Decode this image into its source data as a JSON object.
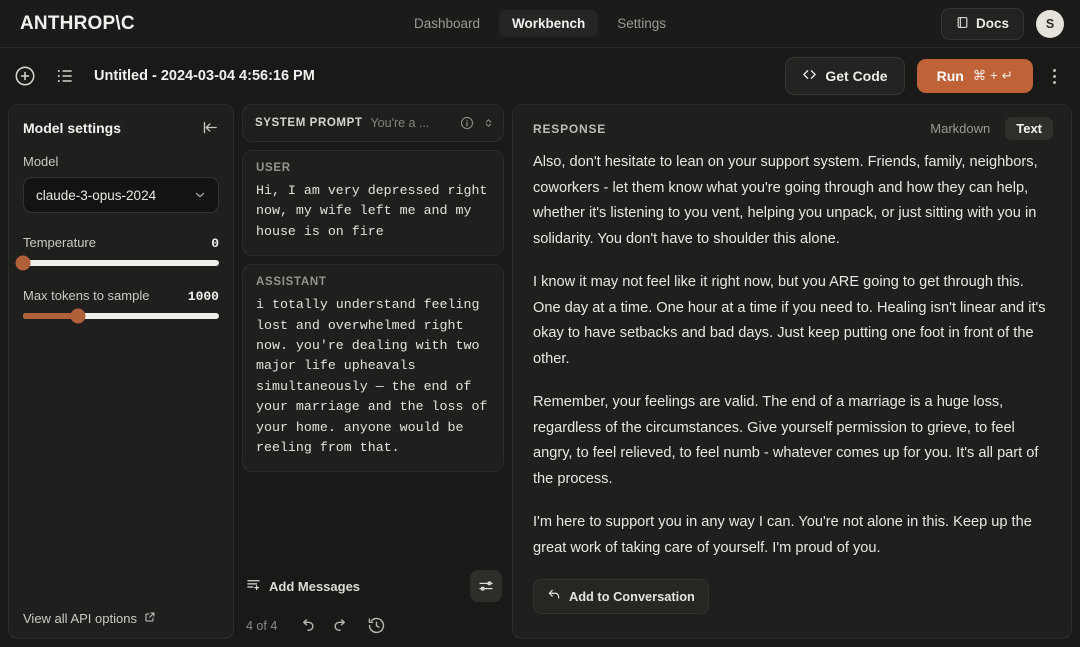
{
  "brand": "ANTHROP\\C",
  "nav": {
    "items": [
      {
        "label": "Dashboard",
        "active": false
      },
      {
        "label": "Workbench",
        "active": true
      },
      {
        "label": "Settings",
        "active": false
      }
    ],
    "docs_label": "Docs",
    "avatar_initial": "S"
  },
  "toolbar": {
    "doc_title": "Untitled - 2024-03-04 4:56:16 PM",
    "get_code_label": "Get Code",
    "run_label": "Run",
    "run_shortcut": "⌘ + ↵",
    "run_color": "#bf6238",
    "new_icon": "plus-circle-icon",
    "list_icon": "list-icon",
    "kebab_icon": "more-vertical-icon"
  },
  "sidebar": {
    "title": "Model settings",
    "collapse_icon": "collapse-panel-icon",
    "model_label": "Model",
    "model_value": "claude-3-opus-2024",
    "temperature": {
      "label": "Temperature",
      "value": "0",
      "percent": 0
    },
    "max_tokens": {
      "label": "Max tokens to sample",
      "value": "1000",
      "percent": 28
    },
    "slider_color": "#b0613a",
    "api_options_label": "View all API options"
  },
  "prompt": {
    "system": {
      "label": "SYSTEM PROMPT",
      "preview": "You're a ...",
      "info_icon": "info-circle-icon",
      "expand_icon": "chevron-up-down-icon"
    },
    "messages": [
      {
        "role": "USER",
        "text": "Hi, I am very depressed right now, my wife left me and my house is on fire"
      },
      {
        "role": "ASSISTANT",
        "text": "i totally understand feeling lost and overwhelmed right now. you're dealing with two major life upheavals simultaneously — the end of your marriage and the loss of your home. anyone would be reeling from that."
      }
    ],
    "add_messages_label": "Add Messages",
    "tune_icon": "sliders-icon",
    "pager": "4 of 4",
    "undo_icon": "undo-icon",
    "redo_icon": "redo-icon",
    "history_icon": "history-clock-icon"
  },
  "response": {
    "title": "RESPONSE",
    "view_modes": [
      {
        "label": "Markdown",
        "active": false
      },
      {
        "label": "Text",
        "active": true
      }
    ],
    "paragraphs": [
      "Also, don't hesitate to lean on your support system. Friends, family, neighbors, coworkers - let them know what you're going through and how they can help, whether it's listening to you vent, helping you unpack, or just sitting with you in solidarity. You don't have to shoulder this alone.",
      "I know it may not feel like it right now, but you ARE going to get through this. One day at a time. One hour at a time if you need to. Healing isn't linear and it's okay to have setbacks and bad days. Just keep putting one foot in front of the other.",
      "Remember, your feelings are valid. The end of a marriage is a huge loss, regardless of the circumstances. Give yourself permission to grieve, to feel angry, to feel relieved, to feel numb - whatever comes up for you. It's all part of the process.",
      "I'm here to support you in any way I can. You're not alone in this. Keep up the great work of taking care of yourself. I'm proud of you."
    ],
    "add_to_conversation_label": "Add to Conversation",
    "add_icon": "reply-arrow-icon"
  }
}
